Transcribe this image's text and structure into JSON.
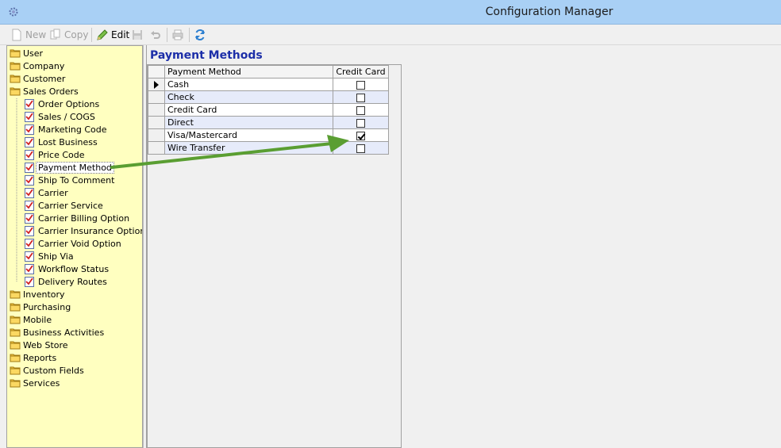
{
  "window": {
    "title": "Configuration Manager"
  },
  "toolbar": {
    "new_label": "New",
    "copy_label": "Copy",
    "edit_label": "Edit"
  },
  "tree": {
    "items": [
      {
        "label": "User",
        "type": "folder",
        "level": 0
      },
      {
        "label": "Company",
        "type": "folder",
        "level": 0
      },
      {
        "label": "Customer",
        "type": "folder",
        "level": 0
      },
      {
        "label": "Sales Orders",
        "type": "folder",
        "level": 0
      },
      {
        "label": "Order Options",
        "type": "check",
        "level": 1
      },
      {
        "label": "Sales / COGS",
        "type": "check",
        "level": 1
      },
      {
        "label": "Marketing Code",
        "type": "check",
        "level": 1
      },
      {
        "label": "Lost Business",
        "type": "check",
        "level": 1
      },
      {
        "label": "Price Code",
        "type": "check",
        "level": 1
      },
      {
        "label": "Payment Method",
        "type": "check",
        "level": 1,
        "selected": true
      },
      {
        "label": "Ship To Comment",
        "type": "check",
        "level": 1
      },
      {
        "label": "Carrier",
        "type": "check",
        "level": 1
      },
      {
        "label": "Carrier Service",
        "type": "check",
        "level": 1
      },
      {
        "label": "Carrier Billing Option",
        "type": "check",
        "level": 1
      },
      {
        "label": "Carrier Insurance Option",
        "type": "check",
        "level": 1
      },
      {
        "label": "Carrier Void Option",
        "type": "check",
        "level": 1
      },
      {
        "label": "Ship Via",
        "type": "check",
        "level": 1
      },
      {
        "label": "Workflow Status",
        "type": "check",
        "level": 1
      },
      {
        "label": "Delivery Routes",
        "type": "check",
        "level": 1
      },
      {
        "label": "Inventory",
        "type": "folder",
        "level": 0
      },
      {
        "label": "Purchasing",
        "type": "folder",
        "level": 0
      },
      {
        "label": "Mobile",
        "type": "folder",
        "level": 0
      },
      {
        "label": "Business Activities",
        "type": "folder",
        "level": 0
      },
      {
        "label": "Web Store",
        "type": "folder",
        "level": 0
      },
      {
        "label": "Reports",
        "type": "folder",
        "level": 0
      },
      {
        "label": "Custom Fields",
        "type": "folder",
        "level": 0
      },
      {
        "label": "Services",
        "type": "folder",
        "level": 0
      }
    ]
  },
  "main": {
    "title": "Payment Methods",
    "columns": [
      "Payment Method",
      "Credit Card"
    ],
    "rows": [
      {
        "name": "Cash",
        "credit_card": false,
        "current": true
      },
      {
        "name": "Check",
        "credit_card": false
      },
      {
        "name": "Credit Card",
        "credit_card": false
      },
      {
        "name": "Direct",
        "credit_card": false
      },
      {
        "name": "Visa/Mastercard",
        "credit_card": true
      },
      {
        "name": "Wire Transfer",
        "credit_card": false
      }
    ]
  },
  "colors": {
    "title_bar": "#a9d0f5",
    "tree_bg": "#ffffc0",
    "heading": "#1c2ea8",
    "annotation_arrow": "#5a9e32"
  }
}
